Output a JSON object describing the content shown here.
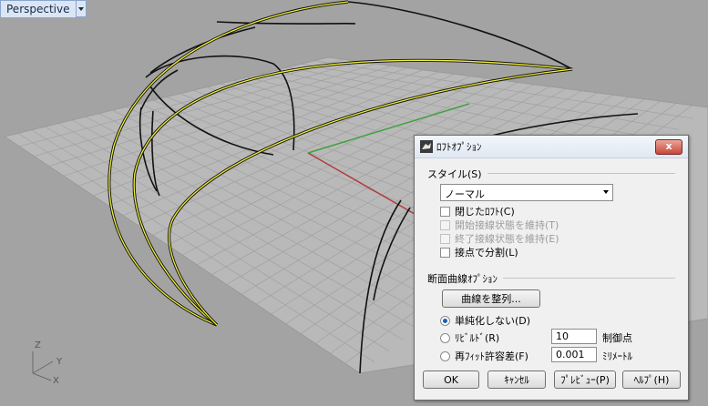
{
  "viewport": {
    "name": "Perspective",
    "axes": {
      "z": "Z",
      "y": "Y",
      "x": "X"
    }
  },
  "dialog": {
    "title": "ﾛﾌﾄｵﾌﾟｼｮﾝ",
    "close": "x",
    "style_section": "スタイル(S)",
    "style_value": "ノーマル",
    "checkboxes": [
      {
        "label": "閉じたﾛﾌﾄ(C)",
        "checked": false,
        "enabled": true
      },
      {
        "label": "開始接線状態を維持(T)",
        "checked": false,
        "enabled": false
      },
      {
        "label": "終了接線状態を維持(E)",
        "checked": false,
        "enabled": false
      },
      {
        "label": "接点で分割(L)",
        "checked": false,
        "enabled": true
      }
    ],
    "section_section": "断面曲線ｵﾌﾟｼｮﾝ",
    "align_button": "曲線を整列...",
    "radios": [
      {
        "label": "単純化しない(D)",
        "selected": true
      },
      {
        "label": "ﾘﾋﾞﾙﾄﾞ(R)",
        "selected": false,
        "value": "10",
        "unit": "制御点"
      },
      {
        "label": "再ﾌｨｯﾄ許容差(F)",
        "selected": false,
        "value": "0.001",
        "unit": "ﾐﾘﾒｰﾄﾙ"
      }
    ],
    "buttons": {
      "ok": "OK",
      "cancel": "ｷｬﾝｾﾙ",
      "preview": "ﾌﾟﾚﾋﾞｭｰ(P)",
      "help": "ﾍﾙﾌﾟ(H)"
    }
  },
  "colors": {
    "grid_bg": "#b9b9b9",
    "grid_line": "#9c9c9c",
    "x_axis": "#b23a3a",
    "y_axis": "#3ea23e",
    "curve_yellow": "#f0ef3a"
  }
}
